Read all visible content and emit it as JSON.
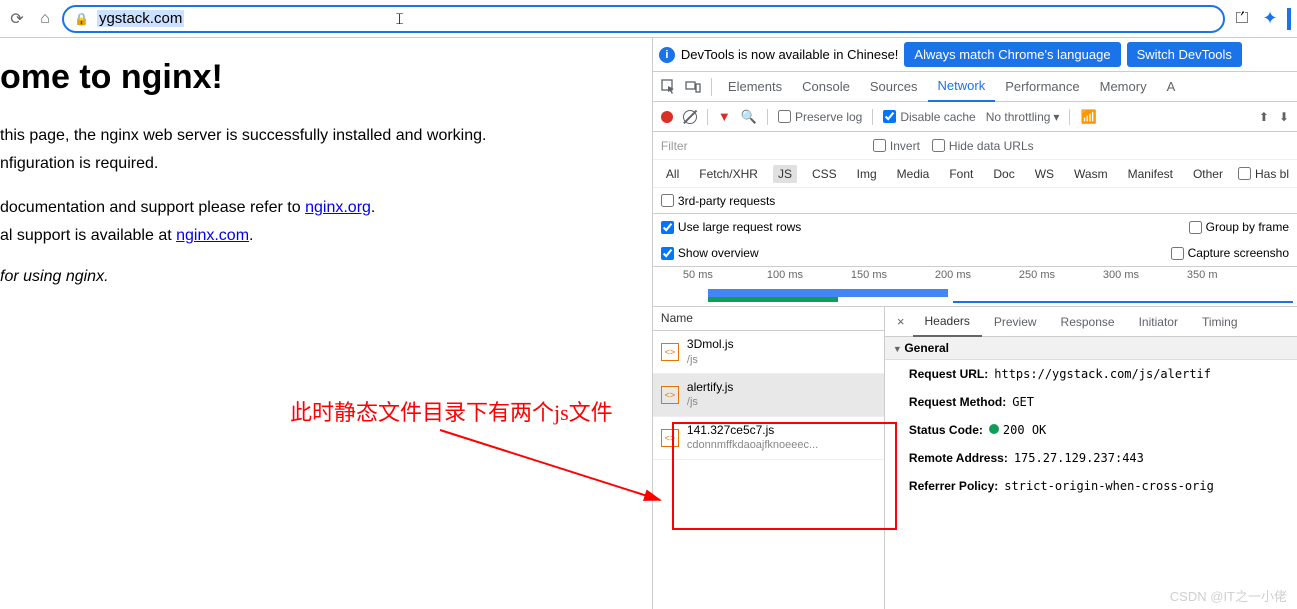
{
  "addr": {
    "url": "ygstack.com"
  },
  "page": {
    "heading": "ome to nginx!",
    "p1a": "this page, the nginx web server is successfully installed and working.",
    "p1b": "nfiguration is required.",
    "p2a": "documentation and support please refer to ",
    "p2a_link": "nginx.org",
    "p2b": "al support is available at ",
    "p2b_link": "nginx.com",
    "thanks": "for using nginx."
  },
  "annotation": "此时静态文件目录下有两个js文件",
  "banner": {
    "text": "DevTools is now available in Chinese!",
    "btn1": "Always match Chrome's language",
    "btn2": "Switch DevTools"
  },
  "tabs": {
    "elements": "Elements",
    "console": "Console",
    "sources": "Sources",
    "network": "Network",
    "performance": "Performance",
    "memory": "Memory",
    "app": "A"
  },
  "toolbar": {
    "preserve": "Preserve log",
    "disable_cache": "Disable cache",
    "throttle": "No throttling"
  },
  "filter": {
    "placeholder": "Filter",
    "invert": "Invert",
    "hide_urls": "Hide data URLs"
  },
  "types": {
    "all": "All",
    "fetch": "Fetch/XHR",
    "js": "JS",
    "css": "CSS",
    "img": "Img",
    "media": "Media",
    "font": "Font",
    "doc": "Doc",
    "ws": "WS",
    "wasm": "Wasm",
    "manifest": "Manifest",
    "other": "Other",
    "has_bl": "Has bl"
  },
  "third": "3rd-party requests",
  "opts": {
    "large_rows": "Use large request rows",
    "group_frame": "Group by frame",
    "show_overview": "Show overview",
    "capture_ss": "Capture screensho"
  },
  "timeline": {
    "t1": "50 ms",
    "t2": "100 ms",
    "t3": "150 ms",
    "t4": "200 ms",
    "t5": "250 ms",
    "t6": "300 ms",
    "t7": "350 m"
  },
  "reqlist": {
    "header": "Name",
    "items": [
      {
        "name": "3Dmol.js",
        "path": "/js"
      },
      {
        "name": "alertify.js",
        "path": "/js"
      },
      {
        "name": "141.327ce5c7.js",
        "path": "cdonnmffkdaoajfknoeeec..."
      }
    ]
  },
  "detail_tabs": {
    "headers": "Headers",
    "preview": "Preview",
    "response": "Response",
    "initiator": "Initiator",
    "timing": "Timing"
  },
  "general": {
    "title": "General",
    "url_k": "Request URL:",
    "url_v": "https://ygstack.com/js/alertif",
    "method_k": "Request Method:",
    "method_v": "GET",
    "status_k": "Status Code:",
    "status_v": "200 OK",
    "remote_k": "Remote Address:",
    "remote_v": "175.27.129.237:443",
    "referrer_k": "Referrer Policy:",
    "referrer_v": "strict-origin-when-cross-orig"
  },
  "watermark": "CSDN @IT之一小佬"
}
